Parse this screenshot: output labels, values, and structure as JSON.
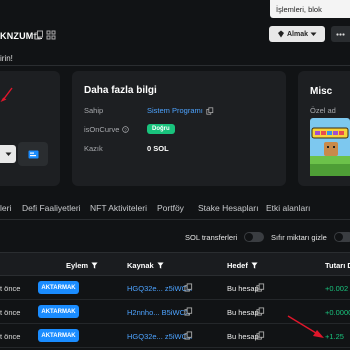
{
  "tooltip": "İşlemleri, blok",
  "header": {
    "address_fragment": "KNZUMfL",
    "buy_label": "Almak"
  },
  "banner": {
    "text": "irin!"
  },
  "info_card": {
    "title": "Daha fazla bilgi",
    "owner_label": "Sahip",
    "owner_value": "Sistem Programı",
    "curve_label": "isOnCurve",
    "curve_badge": "Doğru",
    "rent_label": "Kazık",
    "rent_value": "0 SOL"
  },
  "misc_card": {
    "title": "Misc",
    "subtitle": "Özel ad"
  },
  "tabs": [
    {
      "label": "leri"
    },
    {
      "label": "Defi Faaliyetleri"
    },
    {
      "label": "NFT Aktiviteleri"
    },
    {
      "label": "Portföy"
    },
    {
      "label": "Stake Hesapları"
    },
    {
      "label": "Etki alanları"
    }
  ],
  "filters": {
    "sol_transfers": "SOL transferleri",
    "zero_hide": "Sıfır miktarı gizle"
  },
  "table": {
    "headers": {
      "action": "Eylem",
      "source": "Kaynak",
      "target": "Hedef",
      "amount": "Tutarı D"
    },
    "rows": [
      {
        "time": "t önce",
        "action": "AKTARMAK",
        "source": "HGQ32e... z5iWCX",
        "target": "Bu hesap",
        "amount": "+0.002"
      },
      {
        "time": "t önce",
        "action": "AKTARMAK",
        "source": "H2nnho... B5iWCX",
        "target": "Bu hesap",
        "amount": "+0.0000"
      },
      {
        "time": "t önce",
        "action": "AKTARMAK",
        "source": "HGQ32e... z5iWCX",
        "target": "Bu hesap",
        "amount": "+1.25"
      }
    ]
  },
  "colors": {
    "accent_blue": "#1a8cff",
    "link_blue": "#4da3ff",
    "positive_green": "#19c37d",
    "annotation_red": "#e0162b"
  }
}
